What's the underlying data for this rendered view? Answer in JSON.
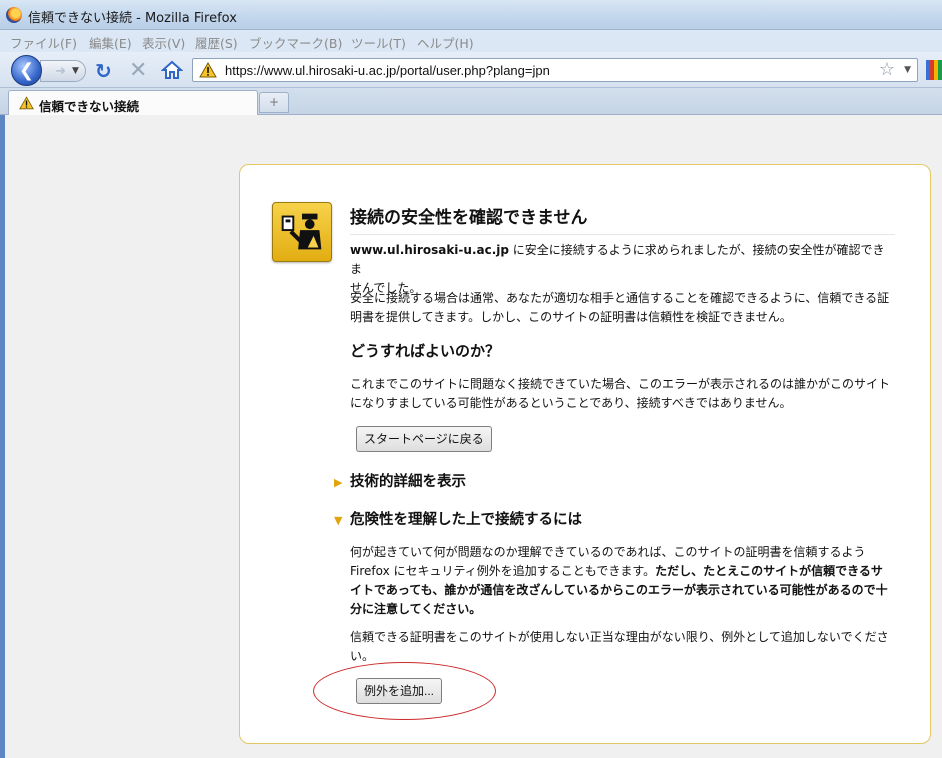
{
  "window": {
    "title": "信頼できない接続 - Mozilla Firefox"
  },
  "menu": [
    "ファイル(F)",
    "編集(E)",
    "表示(V)",
    "履歴(S)",
    "ブックマーク(B)",
    "ツール(T)",
    "ヘルプ(H)"
  ],
  "navbar": {
    "url": "https://www.ul.hirosaki-u.ac.jp/portal/user.php?plang=jpn"
  },
  "tabs": [
    {
      "label": "信頼できない接続"
    }
  ],
  "newtab": "+",
  "error": {
    "title": "接続の安全性を確認できません",
    "intro_host": "www.ul.hirosaki-u.ac.jp",
    "intro_line1_rest": " に安全に接続するように求められましたが、接続の安全性が確認できま",
    "intro_line2": "せんでした。",
    "para2_line1": "安全に接続する場合は通常、あなたが適切な相手と通信することを確認できるように、信頼できる証",
    "para2_line2": "明書を提供してきます。しかし、このサイトの証明書は信頼性を検証できません。",
    "whatdo_title": "どうすればよいのか？",
    "whatdo_line1": "これまでこのサイトに問題なく接続できていた場合、このエラーが表示されるのは誰かがこのサイト",
    "whatdo_line2": "になりすましている可能性があるということであり、接続すべきではありません。",
    "back_button": "スタートページに戻る",
    "tech_details": "技術的詳細を表示",
    "understand_risks": "危険性を理解した上で接続するには",
    "risk_line1": "何が起きていて何が問題なのか理解できているのであれば、このサイトの証明書を信頼するよう",
    "risk_line2_normal": "Firefox にセキュリティ例外を追加することもできます。",
    "risk_line2_bold": "ただし、たとえこのサイトが信頼できるサ",
    "risk_line3_bold": "イトであっても、誰かが通信を改ざんしているからこのエラーが表示されている可能性があるので十",
    "risk_line4_bold": "分に注意してください。",
    "warn_line1": "信頼できる証明書をこのサイトが使用しない正当な理由がない限り、例外として追加しないでくださ",
    "warn_line2": "い。",
    "add_exception_button": "例外を追加..."
  },
  "colors": {
    "accent": "#e1a40c",
    "highlight": "#cc2a2a",
    "frame": "#e4c666"
  }
}
